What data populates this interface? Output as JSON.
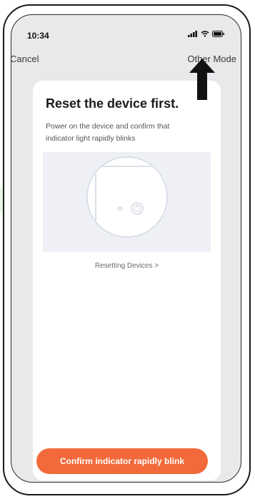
{
  "status_bar": {
    "time": "10:34"
  },
  "nav": {
    "cancel_label": "Cancel",
    "other_mode_label": "Other Mode"
  },
  "card": {
    "title": "Reset the device first.",
    "description": "Power on the device and confirm that indicator light rapidly blinks",
    "reset_link_label": "Resetting Devices >"
  },
  "actions": {
    "confirm_label": "Confirm indicator rapidly blink"
  },
  "colors": {
    "accent": "#f26a3b",
    "background": "#e9e9ec",
    "card": "#ffffff",
    "watermark": "#dff4dc"
  },
  "icons": [
    "signal-icon",
    "wifi-icon",
    "battery-icon",
    "arrow-up-icon",
    "power-icon",
    "device-illustration"
  ]
}
